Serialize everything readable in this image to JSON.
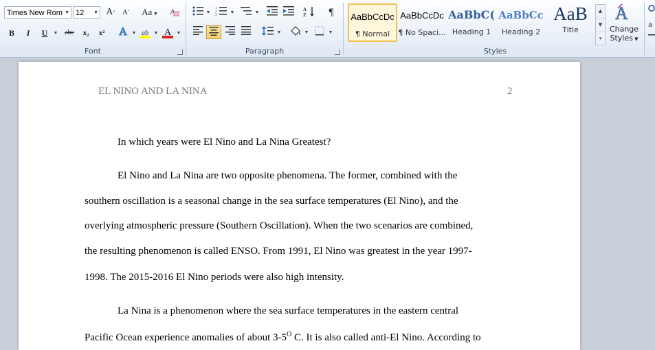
{
  "font": {
    "name_value": "Times New Rom",
    "size_value": "12",
    "grow_glyph": "A",
    "shrink_glyph": "A",
    "change_case_glyph": "Aa",
    "clear_glyph": "A",
    "bold": "B",
    "italic": "I",
    "underline": "U",
    "strike": "abc",
    "subscript": "x₂",
    "superscript": "x²",
    "effects_glyph": "A",
    "highlight_glyph": "ab",
    "fontcolor_glyph": "A",
    "group_label": "Font",
    "highlight_color": "#ffff00",
    "font_color": "#e02020"
  },
  "paragraph": {
    "group_label": "Paragraph",
    "pilcrow": "¶",
    "active_alignment": "center"
  },
  "styles": {
    "group_label": "Styles",
    "items": [
      {
        "sample": "AaBbCcDc",
        "name": "¶ Normal",
        "selected": true
      },
      {
        "sample": "AaBbCcDc",
        "name": "¶ No Spaci...",
        "selected": false
      },
      {
        "sample": "AaBbC(",
        "name": "Heading 1",
        "selected": false
      },
      {
        "sample": "AaBbCc",
        "name": "Heading 2",
        "selected": false
      },
      {
        "sample": "AaB",
        "name": "Title",
        "selected": false
      }
    ],
    "change_styles_line1": "Change",
    "change_styles_line2": "Styles"
  },
  "document": {
    "header_title": "EL NINO AND LA NINA",
    "page_number": "2",
    "question": "In which years were El Nino and La Nina Greatest?",
    "para1_lines": [
      "El Nino and La Nina are two opposite phenomena. The former, combined with the",
      "southern oscillation is a seasonal change in the sea surface temperatures (El Nino), and the",
      "overlying atmospheric pressure (Southern Oscillation). When the two scenarios are combined,",
      "the resulting phenomenon is called ENSO. From 1991, El Nino was greatest in the year 1997-",
      "1998. The 2015-2016 El Nino periods were also high intensity."
    ],
    "para2_line1": "La Nina is a phenomenon where the sea surface temperatures in the eastern central",
    "para2_line2_a": "Pacific Ocean experience anomalies of about 3-5",
    "para2_line2_sup": "O",
    "para2_line2_b": " C. It is also called anti-El Nino. According to"
  }
}
